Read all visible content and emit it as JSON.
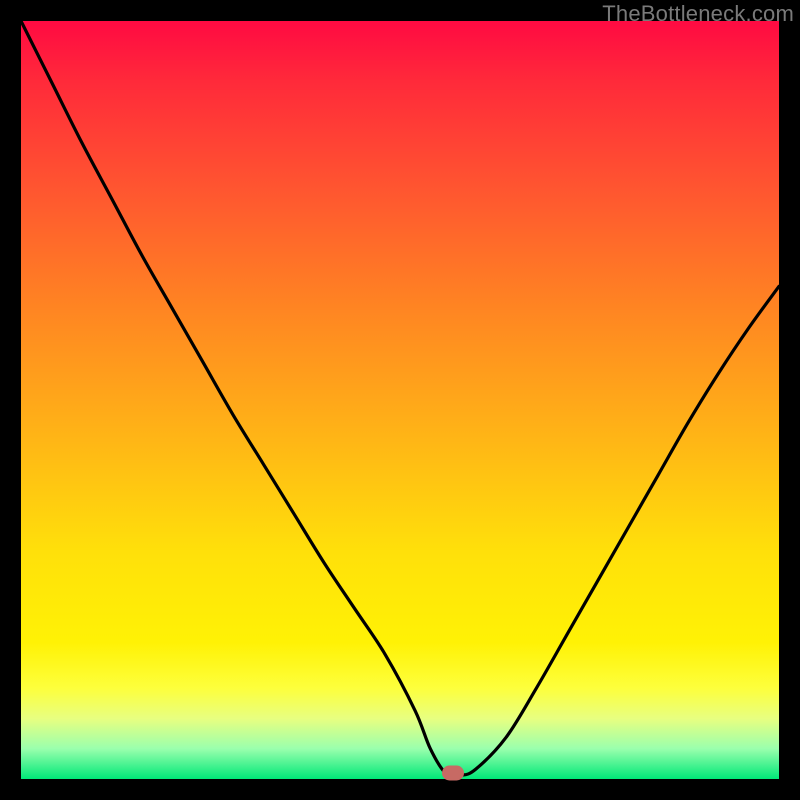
{
  "watermark": {
    "text": "TheBottleneck.com"
  },
  "chart_data": {
    "type": "line",
    "title": "",
    "xlabel": "",
    "ylabel": "",
    "xlim": [
      0,
      100
    ],
    "ylim": [
      0,
      100
    ],
    "grid": false,
    "legend_position": "none",
    "background_gradient": {
      "top_color": "#ff0a42",
      "bottom_color": "#00e878"
    },
    "series": [
      {
        "name": "bottleneck-curve",
        "x": [
          0,
          4,
          8,
          12,
          16,
          20,
          24,
          28,
          32,
          36,
          40,
          44,
          48,
          52,
          54,
          56,
          58,
          60,
          64,
          68,
          72,
          76,
          80,
          84,
          88,
          92,
          96,
          100
        ],
        "y": [
          100,
          92,
          84,
          76.5,
          69,
          62,
          55,
          48,
          41.5,
          35,
          28.5,
          22.5,
          16.5,
          9,
          4,
          0.8,
          0.5,
          1.3,
          5.5,
          12,
          19,
          26,
          33,
          40,
          47,
          53.5,
          59.5,
          65
        ]
      }
    ],
    "marker": {
      "x": 57,
      "y": 0.8,
      "color": "#c76a64"
    }
  }
}
